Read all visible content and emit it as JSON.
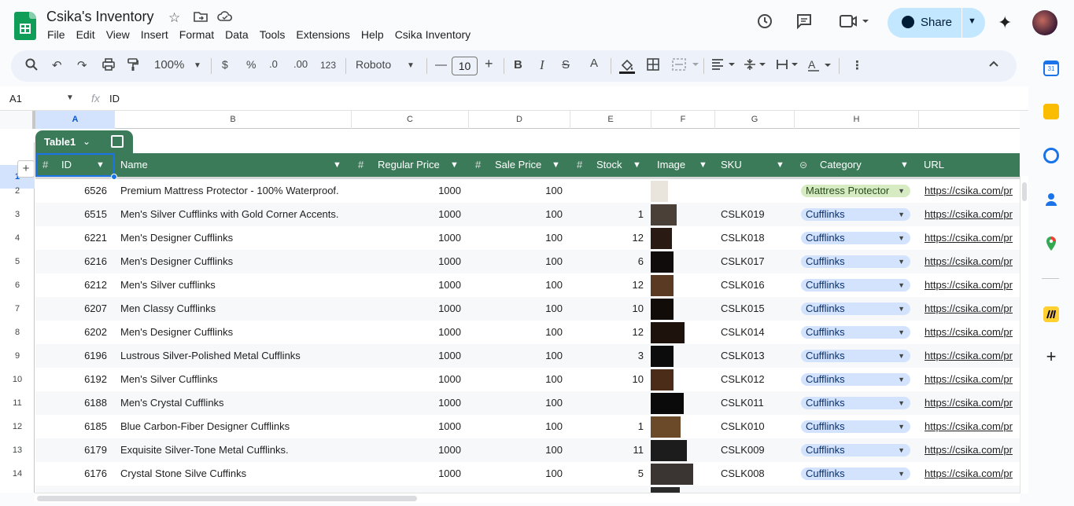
{
  "app": {
    "title": "Csika's Inventory",
    "menu": [
      "File",
      "Edit",
      "View",
      "Insert",
      "Format",
      "Data",
      "Tools",
      "Extensions",
      "Help",
      "Csika Inventory"
    ],
    "share_label": "Share"
  },
  "toolbar": {
    "zoom": "100%",
    "currency": "$",
    "percent": "%",
    "dec_decrease": ".0",
    "dec_increase": ".00",
    "number_format": "123",
    "font": "Roboto",
    "font_size": "10"
  },
  "formula_bar": {
    "cell_ref": "A1",
    "fx": "fx",
    "value": "ID"
  },
  "columns": [
    "A",
    "B",
    "C",
    "D",
    "E",
    "F",
    "G",
    "H"
  ],
  "table": {
    "name": "Table1",
    "headers": [
      "ID",
      "Name",
      "Regular Price",
      "Sale Price",
      "Stock",
      "Image",
      "SKU",
      "Category",
      "URL"
    ],
    "row_numbers": [
      "1",
      "2",
      "3",
      "4",
      "5",
      "6",
      "7",
      "8",
      "9",
      "10",
      "11",
      "12",
      "13",
      "14"
    ],
    "rows": [
      {
        "id": "6526",
        "name": "Premium Mattress Protector - 100% Waterproof.",
        "regular": "1000",
        "sale": "100",
        "stock": "",
        "sku": "",
        "category": "Mattress Protector",
        "url": "https://csika.com/pr"
      },
      {
        "id": "6515",
        "name": "Men's Silver Cufflinks with Gold Corner Accents.",
        "regular": "1000",
        "sale": "100",
        "stock": "1",
        "sku": "CSLK019",
        "category": "Cufflinks",
        "url": "https://csika.com/pr"
      },
      {
        "id": "6221",
        "name": "Men's Designer Cufflinks",
        "regular": "1000",
        "sale": "100",
        "stock": "12",
        "sku": "CSLK018",
        "category": "Cufflinks",
        "url": "https://csika.com/pr"
      },
      {
        "id": "6216",
        "name": "Men's Designer Cufflinks",
        "regular": "1000",
        "sale": "100",
        "stock": "6",
        "sku": "CSLK017",
        "category": "Cufflinks",
        "url": "https://csika.com/pr"
      },
      {
        "id": "6212",
        "name": "Men's Silver cufflinks",
        "regular": "1000",
        "sale": "100",
        "stock": "12",
        "sku": "CSLK016",
        "category": "Cufflinks",
        "url": "https://csika.com/pr"
      },
      {
        "id": "6207",
        "name": "Men Classy Cufflinks",
        "regular": "1000",
        "sale": "100",
        "stock": "10",
        "sku": "CSLK015",
        "category": "Cufflinks",
        "url": "https://csika.com/pr"
      },
      {
        "id": "6202",
        "name": "Men's Designer Cufflinks",
        "regular": "1000",
        "sale": "100",
        "stock": "12",
        "sku": "CSLK014",
        "category": "Cufflinks",
        "url": "https://csika.com/pr"
      },
      {
        "id": "6196",
        "name": "Lustrous Silver-Polished Metal Cufflinks",
        "regular": "1000",
        "sale": "100",
        "stock": "3",
        "sku": "CSLK013",
        "category": "Cufflinks",
        "url": "https://csika.com/pr"
      },
      {
        "id": "6192",
        "name": "Men's Silver Cufflinks",
        "regular": "1000",
        "sale": "100",
        "stock": "10",
        "sku": "CSLK012",
        "category": "Cufflinks",
        "url": "https://csika.com/pr"
      },
      {
        "id": "6188",
        "name": "Men's Crystal Cufflinks",
        "regular": "1000",
        "sale": "100",
        "stock": "",
        "sku": "CSLK011",
        "category": "Cufflinks",
        "url": "https://csika.com/pr"
      },
      {
        "id": "6185",
        "name": "Blue Carbon-Fiber Designer Cufflinks",
        "regular": "1000",
        "sale": "100",
        "stock": "1",
        "sku": "CSLK010",
        "category": "Cufflinks",
        "url": "https://csika.com/pr"
      },
      {
        "id": "6179",
        "name": "Exquisite Silver-Tone Metal Cufflinks.",
        "regular": "1000",
        "sale": "100",
        "stock": "11",
        "sku": "CSLK009",
        "category": "Cufflinks",
        "url": "https://csika.com/pr"
      },
      {
        "id": "6176",
        "name": "Crystal Stone Silve Cuffinks",
        "regular": "1000",
        "sale": "100",
        "stock": "5",
        "sku": "CSLK008",
        "category": "Cufflinks",
        "url": "https://csika.com/pr"
      }
    ]
  },
  "colors": {
    "table_header": "#3c7b5a",
    "chip_blue": "#d3e3fd",
    "chip_green": "#d7ebc3",
    "share_bg": "#c2e7ff",
    "selection": "#1a73e8"
  },
  "icons": {
    "top_right": [
      "history-icon",
      "comment-icon",
      "video-call-icon",
      "gemini-spark-icon"
    ],
    "side_panel": [
      "calendar-icon",
      "keep-icon",
      "tasks-icon",
      "contacts-icon",
      "maps-icon",
      "miro-icon",
      "add-icon"
    ]
  }
}
